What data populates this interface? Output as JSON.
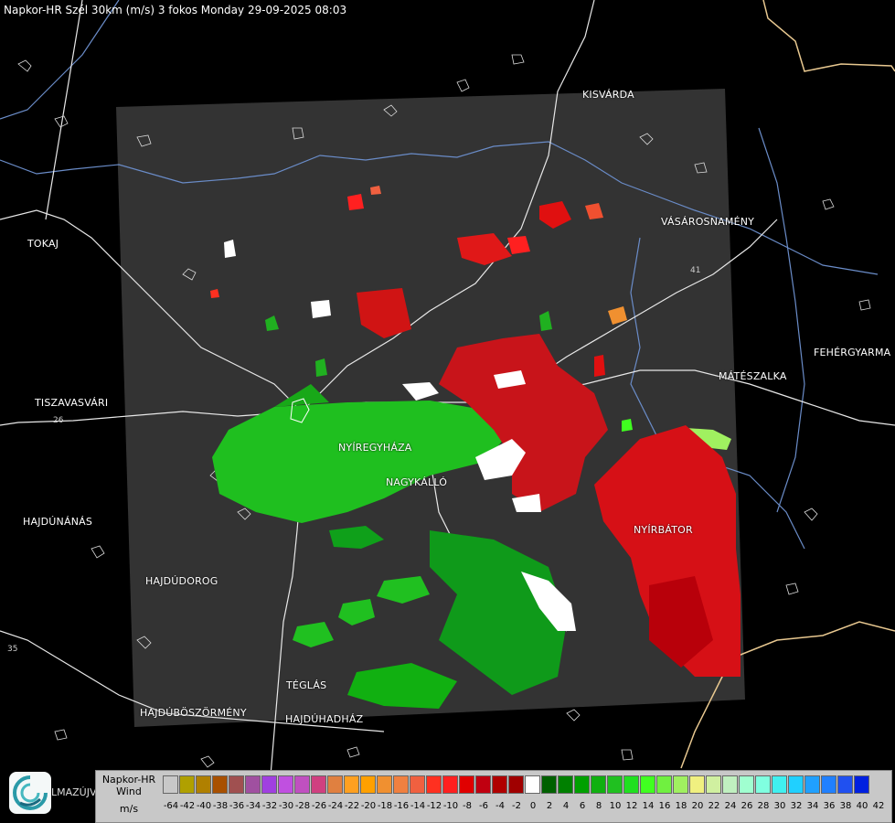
{
  "header": {
    "title": "Napkor-HR Szél 30km (m/s) 3 fokos Monday 29-09-2025 08:03"
  },
  "towns": [
    {
      "id": "kisvarda",
      "label": "KISVÁRDA"
    },
    {
      "id": "tokaj",
      "label": "TOKAJ"
    },
    {
      "id": "vasarosnameny",
      "label": "VÁSÁROSNAMÉNY"
    },
    {
      "id": "fehergyarmat",
      "label": "FEHÉRGYARMA"
    },
    {
      "id": "mateszalka",
      "label": "MÁTÉSZALKA"
    },
    {
      "id": "tiszavasvari",
      "label": "TISZAVASVÁRI"
    },
    {
      "id": "nyiregyhaza",
      "label": "NYÍREGYHÁZA"
    },
    {
      "id": "nagykallo",
      "label": "NAGYKÁLLÓ"
    },
    {
      "id": "hajdunanas",
      "label": "HAJDÚNÁNÁS"
    },
    {
      "id": "nyirbator",
      "label": "NYÍRBÁTOR"
    },
    {
      "id": "hajdudorog",
      "label": "HAJDÚDOROG"
    },
    {
      "id": "teglas",
      "label": "TÉGLÁS"
    },
    {
      "id": "hajduboszormeny",
      "label": "HAJDÚBÖSZÖRMÉNY"
    },
    {
      "id": "hajduhadhaz",
      "label": "HAJDÚHADHÁZ"
    }
  ],
  "road_numbers": [
    "35",
    "26",
    "41"
  ],
  "legend": {
    "name": "Napkor-HR",
    "quantity": "Wind",
    "unit": "m/s",
    "ticks": [
      "-64",
      "-42",
      "-40",
      "-38",
      "-36",
      "-34",
      "-32",
      "-30",
      "-28",
      "-26",
      "-24",
      "-22",
      "-20",
      "-18",
      "-16",
      "-14",
      "-12",
      "-10",
      "-8",
      "-6",
      "-4",
      "-2",
      "0",
      "2",
      "4",
      "6",
      "8",
      "10",
      "12",
      "14",
      "16",
      "18",
      "20",
      "22",
      "24",
      "26",
      "28",
      "30",
      "32",
      "34",
      "36",
      "38",
      "40",
      "42"
    ],
    "colors": [
      "#c8c8c8",
      "#b0a000",
      "#b08000",
      "#a85000",
      "#a05050",
      "#a050a0",
      "#a040e0",
      "#c050e0",
      "#c050c0",
      "#d04080",
      "#e08040",
      "#ffa020",
      "#ffa000",
      "#f09030",
      "#f08040",
      "#f06040",
      "#ff3020",
      "#ff2020",
      "#e00000",
      "#c00010",
      "#b00000",
      "#a00000",
      "#ffffff",
      "#006000",
      "#008000",
      "#00a000",
      "#10b010",
      "#20c020",
      "#20e020",
      "#40ff20",
      "#70f040",
      "#a0f060",
      "#f0f080",
      "#d0f0a0",
      "#c0f0c0",
      "#a0ffd0",
      "#80ffe0",
      "#40f0f0",
      "#20d0ff",
      "#20a0ff",
      "#2080ff",
      "#2050f0",
      "#0020e0"
    ]
  },
  "logo": {
    "text": "LMAZÚJVÁR"
  }
}
